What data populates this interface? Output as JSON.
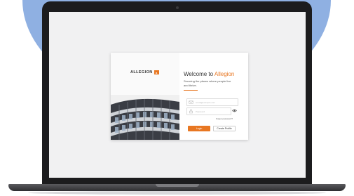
{
  "logo": {
    "text": "ALLEGION",
    "mark": "a"
  },
  "welcome": {
    "prefix": "Welcome to",
    "brand": "Allegion"
  },
  "tagline": "Securing the places where people live and thrive.",
  "email": {
    "placeholder": "email@example.com"
  },
  "password": {
    "placeholder": "Password"
  },
  "forgot_label": "Forgot password?",
  "buttons": {
    "login": "Login",
    "create_profile": "Create Profile"
  },
  "colors": {
    "accent": "#e87722",
    "backdrop": "#8fb0e2"
  },
  "icons": [
    "envelope-icon",
    "lock-icon",
    "eye-icon"
  ]
}
